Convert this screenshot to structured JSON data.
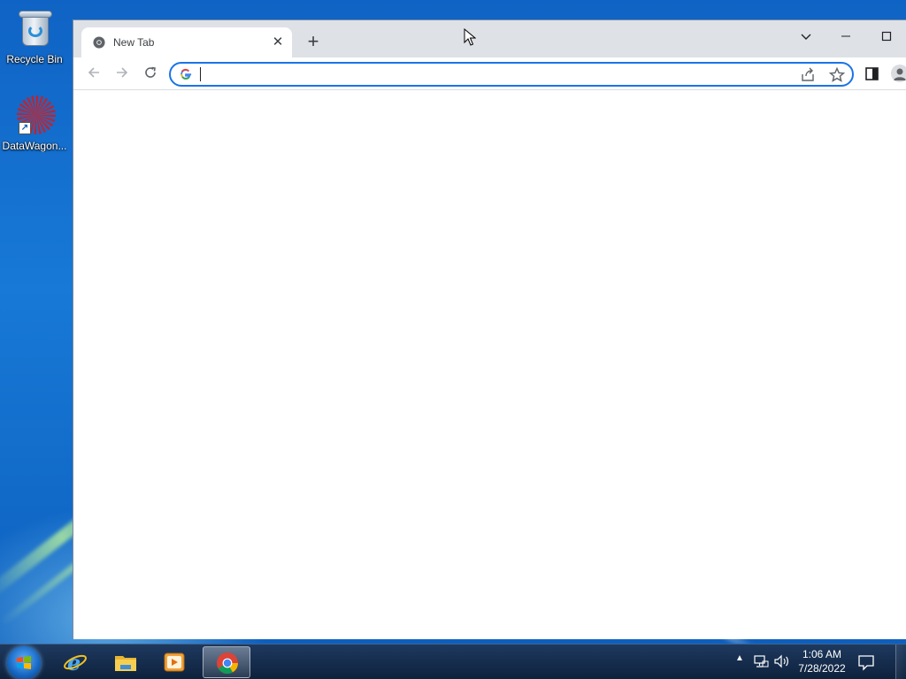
{
  "desktop": {
    "icons": [
      {
        "label": "Recycle Bin",
        "icon": "recycle-bin-icon"
      },
      {
        "label": "DataWagon...",
        "icon": "datawagon-icon"
      }
    ]
  },
  "browser": {
    "tab": {
      "title": "New Tab",
      "favicon": "chrome-icon"
    },
    "omnibox": {
      "value": "",
      "placeholder": ""
    },
    "colors": {
      "accent": "#1a73e8",
      "tabstrip": "#dee1e6"
    }
  },
  "taskbar": {
    "apps": [
      {
        "name": "Internet Explorer",
        "icon": "internet-explorer-icon",
        "active": false
      },
      {
        "name": "File Explorer",
        "icon": "folder-icon",
        "active": false
      },
      {
        "name": "Media Player",
        "icon": "media-player-icon",
        "active": false
      },
      {
        "name": "Google Chrome",
        "icon": "chrome-icon",
        "active": true
      }
    ],
    "clock": {
      "time": "1:06 AM",
      "date": "7/28/2022"
    }
  }
}
